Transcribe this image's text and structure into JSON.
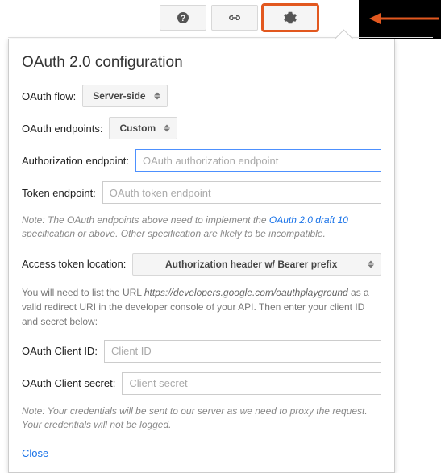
{
  "toolbar": {
    "help_icon": "help",
    "link_icon": "link",
    "gear_icon": "gear"
  },
  "panel": {
    "title": "OAuth 2.0 configuration",
    "flow_label": "OAuth flow:",
    "flow_value": "Server-side",
    "endpoints_label": "OAuth endpoints:",
    "endpoints_value": "Custom",
    "auth_endpoint_label": "Authorization endpoint:",
    "auth_endpoint_placeholder": "OAuth authorization endpoint",
    "token_endpoint_label": "Token endpoint:",
    "token_endpoint_placeholder": "OAuth token endpoint",
    "note1_prefix": "Note: The OAuth endpoints above need to implement the ",
    "note1_link": "OAuth 2.0 draft 10",
    "note1_suffix": " specification or above. Other specification are likely to be incompatible.",
    "token_loc_label": "Access token location:",
    "token_loc_value": "Authorization header w/ Bearer prefix",
    "info_prefix": "You will need to list the URL ",
    "info_url": "https://developers.google.com/oauthplayground",
    "info_suffix": " as a valid redirect URI in the developer console of your API. Then enter your client ID and secret below:",
    "client_id_label": "OAuth Client ID:",
    "client_id_placeholder": "Client ID",
    "client_secret_label": "OAuth Client secret:",
    "client_secret_placeholder": "Client secret",
    "note2": "Note: Your credentials will be sent to our server as we need to proxy the request. Your credentials will not be logged.",
    "close": "Close"
  }
}
